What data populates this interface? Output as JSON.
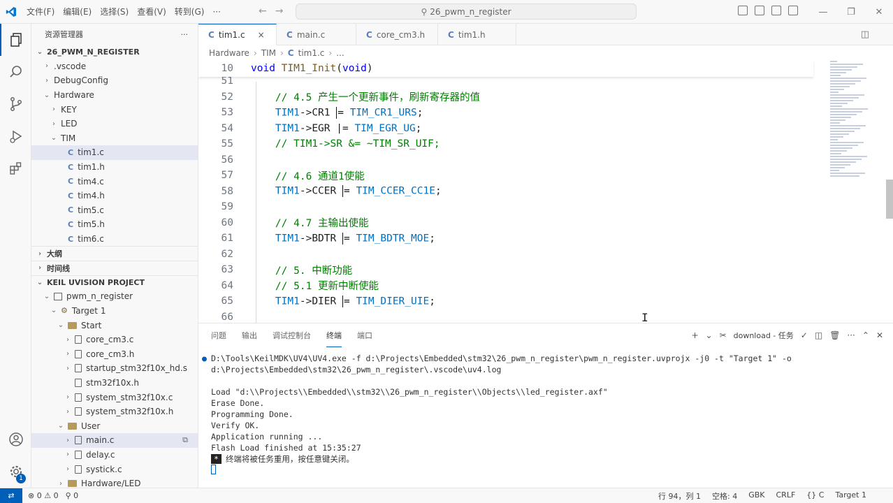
{
  "titlebar": {
    "menu": [
      "文件(F)",
      "编辑(E)",
      "选择(S)",
      "查看(V)",
      "转到(G)",
      "···"
    ],
    "search_text": "26_pwm_n_register"
  },
  "sidebar": {
    "explorer_title": "资源管理器",
    "explorer_more": "···",
    "root": "26_PWM_N_REGISTER",
    "tree": [
      {
        "label": ".vscode",
        "indent": 1,
        "chev": "›",
        "type": "folder"
      },
      {
        "label": "DebugConfig",
        "indent": 1,
        "chev": "›",
        "type": "folder"
      },
      {
        "label": "Hardware",
        "indent": 1,
        "chev": "⌄",
        "type": "folder"
      },
      {
        "label": "KEY",
        "indent": 2,
        "chev": "›",
        "type": "folder"
      },
      {
        "label": "LED",
        "indent": 2,
        "chev": "›",
        "type": "folder"
      },
      {
        "label": "TIM",
        "indent": 2,
        "chev": "⌄",
        "type": "folder"
      },
      {
        "label": "tim1.c",
        "indent": 3,
        "chev": "",
        "type": "c",
        "selected": true
      },
      {
        "label": "tim1.h",
        "indent": 3,
        "chev": "",
        "type": "c"
      },
      {
        "label": "tim4.c",
        "indent": 3,
        "chev": "",
        "type": "c"
      },
      {
        "label": "tim4.h",
        "indent": 3,
        "chev": "",
        "type": "c"
      },
      {
        "label": "tim5.c",
        "indent": 3,
        "chev": "",
        "type": "c"
      },
      {
        "label": "tim5.h",
        "indent": 3,
        "chev": "",
        "type": "c"
      },
      {
        "label": "tim6.c",
        "indent": 3,
        "chev": "",
        "type": "c"
      }
    ],
    "outline": "大纲",
    "timeline": "时间线",
    "keil_title": "KEIL UVISION PROJECT",
    "keil_tree": [
      {
        "label": "pwm_n_register",
        "indent": 1,
        "chev": "⌄",
        "type": "proj"
      },
      {
        "label": "Target 1",
        "indent": 2,
        "chev": "⌄",
        "type": "target"
      },
      {
        "label": "Start",
        "indent": 3,
        "chev": "⌄",
        "type": "folderc"
      },
      {
        "label": "core_cm3.c",
        "indent": 4,
        "chev": "›",
        "type": "file"
      },
      {
        "label": "core_cm3.h",
        "indent": 4,
        "chev": "›",
        "type": "file"
      },
      {
        "label": "startup_stm32f10x_hd.s",
        "indent": 4,
        "chev": "›",
        "type": "asm"
      },
      {
        "label": "stm32f10x.h",
        "indent": 4,
        "chev": "",
        "type": "file"
      },
      {
        "label": "system_stm32f10x.c",
        "indent": 4,
        "chev": "›",
        "type": "file"
      },
      {
        "label": "system_stm32f10x.h",
        "indent": 4,
        "chev": "›",
        "type": "file"
      },
      {
        "label": "User",
        "indent": 3,
        "chev": "⌄",
        "type": "folderc"
      },
      {
        "label": "main.c",
        "indent": 4,
        "chev": "›",
        "type": "file",
        "selected": true
      },
      {
        "label": "delay.c",
        "indent": 4,
        "chev": "›",
        "type": "file"
      },
      {
        "label": "systick.c",
        "indent": 4,
        "chev": "›",
        "type": "file"
      },
      {
        "label": "Hardware/LED",
        "indent": 3,
        "chev": "›",
        "type": "folderc"
      }
    ]
  },
  "tabs": [
    {
      "label": "tim1.c",
      "active": true,
      "close": "×"
    },
    {
      "label": "main.c",
      "active": false
    },
    {
      "label": "core_cm3.h",
      "active": false
    },
    {
      "label": "tim1.h",
      "active": false
    }
  ],
  "breadcrumb": {
    "parts": [
      "Hardware",
      "TIM",
      "tim1.c",
      "..."
    ]
  },
  "editor": {
    "sticky": {
      "ln": "10",
      "tokens": [
        {
          "t": "void ",
          "c": "kw"
        },
        {
          "t": "TIM1_Init",
          "c": "fn"
        },
        {
          "t": "(",
          "c": "plain"
        },
        {
          "t": "void",
          "c": "kw"
        },
        {
          "t": ")",
          "c": "plain"
        }
      ]
    },
    "lines": [
      {
        "ln": "51",
        "tokens": []
      },
      {
        "ln": "52",
        "tokens": [
          {
            "t": "    // 4.5 产生一个更新事件，刷新寄存器的值",
            "c": "cm"
          }
        ]
      },
      {
        "ln": "53",
        "tokens": [
          {
            "t": "    TIM1",
            "c": "mac"
          },
          {
            "t": "->",
            "c": "plain"
          },
          {
            "t": "CR1 ",
            "c": "var"
          },
          {
            "t": "|",
            "c": "cursor"
          },
          {
            "t": "= ",
            "c": "plain"
          },
          {
            "t": "TIM_CR1_URS",
            "c": "mac"
          },
          {
            "t": ";",
            "c": "plain"
          }
        ]
      },
      {
        "ln": "54",
        "tokens": [
          {
            "t": "    TIM1",
            "c": "mac"
          },
          {
            "t": "->",
            "c": "plain"
          },
          {
            "t": "EGR ",
            "c": "var"
          },
          {
            "t": "|= ",
            "c": "plain"
          },
          {
            "t": "TIM_EGR_UG",
            "c": "mac"
          },
          {
            "t": ";",
            "c": "plain"
          }
        ]
      },
      {
        "ln": "55",
        "tokens": [
          {
            "t": "    // TIM1->SR &= ~TIM_SR_UIF;",
            "c": "cm"
          }
        ]
      },
      {
        "ln": "56",
        "tokens": []
      },
      {
        "ln": "57",
        "tokens": [
          {
            "t": "    // 4.6 通道1使能",
            "c": "cm"
          }
        ]
      },
      {
        "ln": "58",
        "tokens": [
          {
            "t": "    TIM1",
            "c": "mac"
          },
          {
            "t": "->",
            "c": "plain"
          },
          {
            "t": "CCER ",
            "c": "var"
          },
          {
            "t": "|",
            "c": "cursor"
          },
          {
            "t": "= ",
            "c": "plain"
          },
          {
            "t": "TIM_CCER_CC1E",
            "c": "mac"
          },
          {
            "t": ";",
            "c": "plain"
          }
        ]
      },
      {
        "ln": "59",
        "tokens": []
      },
      {
        "ln": "60",
        "tokens": [
          {
            "t": "    // 4.7 主输出使能",
            "c": "cm"
          }
        ]
      },
      {
        "ln": "61",
        "tokens": [
          {
            "t": "    TIM1",
            "c": "mac"
          },
          {
            "t": "->",
            "c": "plain"
          },
          {
            "t": "BDTR ",
            "c": "var"
          },
          {
            "t": "|",
            "c": "cursor"
          },
          {
            "t": "= ",
            "c": "plain"
          },
          {
            "t": "TIM_BDTR_MOE",
            "c": "mac"
          },
          {
            "t": ";",
            "c": "plain"
          }
        ]
      },
      {
        "ln": "62",
        "tokens": []
      },
      {
        "ln": "63",
        "tokens": [
          {
            "t": "    // 5. 中断功能",
            "c": "cm"
          }
        ]
      },
      {
        "ln": "64",
        "tokens": [
          {
            "t": "    // 5.1 更新中断使能",
            "c": "cm"
          }
        ]
      },
      {
        "ln": "65",
        "tokens": [
          {
            "t": "    TIM1",
            "c": "mac"
          },
          {
            "t": "->",
            "c": "plain"
          },
          {
            "t": "DIER ",
            "c": "var"
          },
          {
            "t": "|",
            "c": "cursor"
          },
          {
            "t": "= ",
            "c": "plain"
          },
          {
            "t": "TIM_DIER_UIE",
            "c": "mac"
          },
          {
            "t": ";",
            "c": "plain"
          }
        ]
      },
      {
        "ln": "66",
        "tokens": []
      }
    ]
  },
  "panel": {
    "tabs": [
      "问题",
      "输出",
      "调试控制台",
      "终端",
      "端口"
    ],
    "active_tab": "终端",
    "task_label": "download - 任务",
    "terminal_lines": [
      "D:\\Tools\\KeilMDK\\UV4\\UV4.exe -f d:\\Projects\\Embedded\\stm32\\26_pwm_n_register\\pwm_n_register.uvprojx -j0 -t \"Target 1\" -o d:\\Projects\\Embedded\\stm32\\26_pwm_n_register\\.vscode\\uv4.log",
      "",
      "Load \"d:\\\\Projects\\\\Embedded\\\\stm32\\\\26_pwm_n_register\\\\Objects\\\\led_register.axf\"",
      "Erase Done.",
      "Programming Done.",
      "Verify OK.",
      "Application running ...",
      "Flash Load finished at 15:35:27"
    ],
    "terminal_final": "终端将被任务重用，按任意键关闭。",
    "star": "*"
  },
  "statusbar": {
    "errors": "0",
    "warnings": "0",
    "ports": "0",
    "position": "行 94，列 1",
    "spaces": "空格: 4",
    "encoding": "GBK",
    "eol": "CRLF",
    "language": "C",
    "target": "Target 1"
  },
  "colors": {
    "accent": "#005fb8",
    "comment": "#008000",
    "keyword": "#0000ff",
    "function": "#795e26",
    "macro": "#0070c1"
  }
}
